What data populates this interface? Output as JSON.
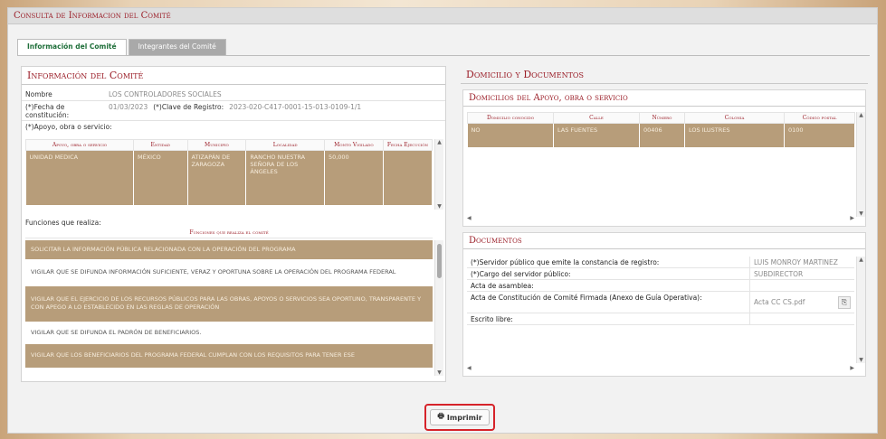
{
  "window_title": "Consulta de Informacion del Comité",
  "tabs": [
    "Información del Comité",
    "Integrantes del Comité"
  ],
  "left": {
    "heading": "Información del Comité",
    "nombre_label": "Nombre",
    "nombre_value": "LOS CONTROLADORES SOCIALES",
    "fecha_label": "(*)Fecha de constitución:",
    "fecha_value": "01/03/2023",
    "clave_label": "(*)Clave de Registro:",
    "clave_value": "2023-020-C417-0001-15-013-0109-1/1",
    "apoyo_label": "(*)Apoyo, obra o servicio:",
    "apoyo_headers": [
      "Apoyo, obra o servicio",
      "Entidad",
      "Municipio",
      "Localidad",
      "Monto Vigilado",
      "Fecha Ejecución"
    ],
    "apoyo_row": [
      "UNIDAD MEDICA",
      "MÉXICO",
      "ATIZAPÁN DE ZARAGOZA",
      "RANCHO NUESTRA SEÑORA DE LOS ÁNGELES",
      "50,000",
      ""
    ],
    "funciones_label": "Funciones que realiza:",
    "funciones_header": "Funciones que realiza el comité",
    "funciones": [
      "SOLICITAR LA INFORMACIÓN PÚBLICA RELACIONADA CON LA OPERACIÓN DEL PROGRAMA",
      "VIGILAR QUE SE DIFUNDA INFORMACIÓN SUFICIENTE, VERAZ Y OPORTUNA SOBRE LA OPERACIÓN DEL PROGRAMA FEDERAL",
      "VIGILAR QUE EL EJERCICIO DE LOS RECURSOS PÚBLICOS PARA LAS OBRAS, APOYOS O SERVICIOS SEA OPORTUNO, TRANSPARENTE Y CON APEGO A LO ESTABLECIDO EN LAS REGLAS DE OPERACIÓN",
      "VIGILAR QUE SE DIFUNDA EL PADRÓN DE BENEFICIARIOS.",
      "VIGILAR QUE LOS BENEFICIARIOS DEL PROGRAMA FEDERAL CUMPLAN CON LOS REQUISITOS PARA TENER ESE"
    ]
  },
  "right": {
    "heading": "Domicilio y Documentos",
    "domicilio_heading": "Domicilios del Apoyo, obra o servicio",
    "domicilio_headers": [
      "Domicilio conocido",
      "Calle",
      "Número",
      "Colonia",
      "Código postal"
    ],
    "domicilio_row": [
      "NO",
      "LAS FUENTES",
      "00406",
      "LOS ILUSTRES",
      "0100"
    ],
    "documentos_heading": "Documentos",
    "documentos": [
      {
        "label": "(*)Servidor público que emite la constancia de registro:",
        "value": "LUIS MONROY MARTINEZ"
      },
      {
        "label": "(*)Cargo del servidor público:",
        "value": "SUBDIRECTOR"
      },
      {
        "label": "Acta de asamblea:",
        "value": ""
      },
      {
        "label": "Acta de Constitución de Comité Firmada (Anexo de Guía Operativa):",
        "value": "Acta CC CS.pdf"
      },
      {
        "label": "Escrito libre:",
        "value": ""
      }
    ]
  },
  "print_label": "Imprimir"
}
